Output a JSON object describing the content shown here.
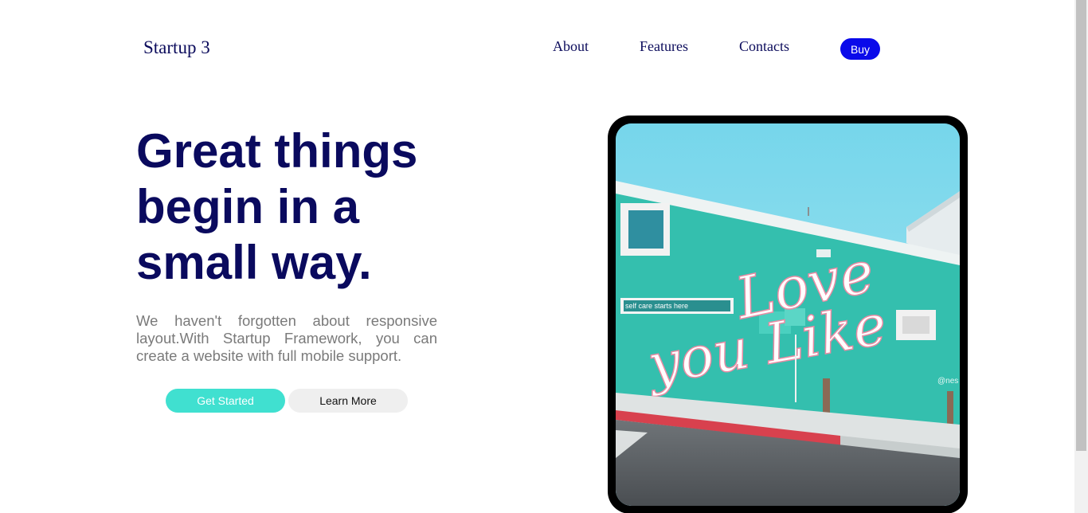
{
  "header": {
    "brand": "Startup 3",
    "nav": {
      "about": "About",
      "features": "Features",
      "contacts": "Contacts"
    },
    "buy_label": "Buy"
  },
  "hero": {
    "title": "Great things begin in a small way.",
    "description": "We haven't forgotten about responsive layout.With Startup Framework, you can create a website with full mobile support.",
    "primary_button": "Get Started",
    "secondary_button": "Learn More"
  },
  "photo": {
    "sign_text": "self care starts here",
    "mural_line1": "Love",
    "mural_line2": "you Like",
    "watermark": "@nes"
  },
  "colors": {
    "brand_text": "#0c0c5c",
    "buy_button": "#0a0aea",
    "get_started": "#40e0d0",
    "learn_more": "#efefef",
    "wall": "#34bfae"
  }
}
